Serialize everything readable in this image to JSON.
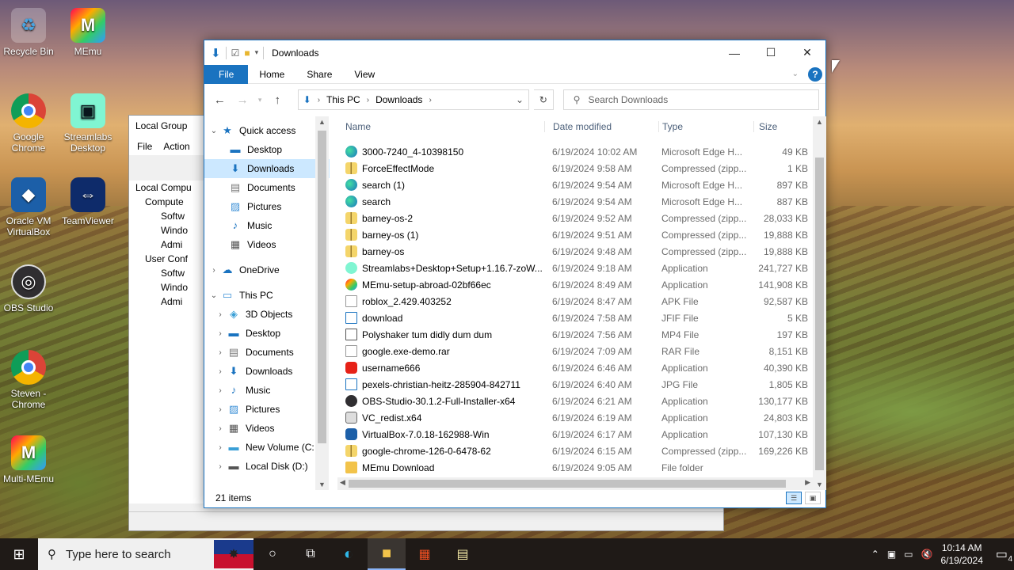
{
  "desktop": {
    "icons": [
      {
        "label": "Recycle Bin",
        "icon": "recycle-bin-icon"
      },
      {
        "label": "MEmu",
        "icon": "memu-icon"
      },
      {
        "label": "Google Chrome",
        "icon": "chrome-icon"
      },
      {
        "label": "Streamlabs Desktop",
        "icon": "streamlabs-icon"
      },
      {
        "label": "Oracle VM VirtualBox",
        "icon": "virtualbox-icon"
      },
      {
        "label": "TeamViewer",
        "icon": "teamviewer-icon"
      },
      {
        "label": "OBS Studio",
        "icon": "obs-icon"
      },
      {
        "label": "Steven - Chrome",
        "icon": "chrome-profile-icon"
      },
      {
        "label": "Multi-MEmu",
        "icon": "multi-memu-icon"
      }
    ]
  },
  "bg_window": {
    "title": "Local Group",
    "menu": [
      "File",
      "Action"
    ],
    "tree": [
      "Local Compu",
      "Compute",
      "Softw",
      "Windo",
      "Admi",
      "User Conf",
      "Softw",
      "Windo",
      "Admi"
    ]
  },
  "explorer": {
    "title": "Downloads",
    "ribbon": {
      "file": "File",
      "home": "Home",
      "share": "Share",
      "view": "View",
      "help": "?"
    },
    "breadcrumb": [
      "This PC",
      "Downloads"
    ],
    "search_placeholder": "Search Downloads",
    "nav": {
      "quick_access": "Quick access",
      "quick_items": [
        "Desktop",
        "Downloads",
        "Documents",
        "Pictures",
        "Music",
        "Videos"
      ],
      "onedrive": "OneDrive",
      "this_pc": "This PC",
      "pc_items": [
        "3D Objects",
        "Desktop",
        "Documents",
        "Downloads",
        "Music",
        "Pictures",
        "Videos",
        "New Volume (C:",
        "Local Disk (D:)"
      ]
    },
    "columns": {
      "name": "Name",
      "date": "Date modified",
      "type": "Type",
      "size": "Size"
    },
    "files": [
      {
        "name": "3000-7240_4-10398150",
        "date": "6/19/2024 10:02 AM",
        "type": "Microsoft Edge H...",
        "size": "49 KB",
        "icon": "edge"
      },
      {
        "name": "ForceEffectMode",
        "date": "6/19/2024 9:58 AM",
        "type": "Compressed (zipp...",
        "size": "1 KB",
        "icon": "zip"
      },
      {
        "name": "search (1)",
        "date": "6/19/2024 9:54 AM",
        "type": "Microsoft Edge H...",
        "size": "897 KB",
        "icon": "edge"
      },
      {
        "name": "search",
        "date": "6/19/2024 9:54 AM",
        "type": "Microsoft Edge H...",
        "size": "887 KB",
        "icon": "edge"
      },
      {
        "name": "barney-os-2",
        "date": "6/19/2024 9:52 AM",
        "type": "Compressed (zipp...",
        "size": "28,033 KB",
        "icon": "zip"
      },
      {
        "name": "barney-os (1)",
        "date": "6/19/2024 9:51 AM",
        "type": "Compressed (zipp...",
        "size": "19,888 KB",
        "icon": "zip"
      },
      {
        "name": "barney-os",
        "date": "6/19/2024 9:48 AM",
        "type": "Compressed (zipp...",
        "size": "19,888 KB",
        "icon": "zip"
      },
      {
        "name": "Streamlabs+Desktop+Setup+1.16.7-zoW...",
        "date": "6/19/2024 9:18 AM",
        "type": "Application",
        "size": "241,727 KB",
        "icon": "streamlabs"
      },
      {
        "name": "MEmu-setup-abroad-02bf66ec",
        "date": "6/19/2024 8:49 AM",
        "type": "Application",
        "size": "141,908 KB",
        "icon": "memu"
      },
      {
        "name": "roblox_2.429.403252",
        "date": "6/19/2024 8:47 AM",
        "type": "APK File",
        "size": "92,587 KB",
        "icon": "file"
      },
      {
        "name": "download",
        "date": "6/19/2024 7:58 AM",
        "type": "JFIF File",
        "size": "5 KB",
        "icon": "image"
      },
      {
        "name": "Polyshaker tum didly dum dum",
        "date": "6/19/2024 7:56 AM",
        "type": "MP4 File",
        "size": "197 KB",
        "icon": "video"
      },
      {
        "name": "google.exe-demo.rar",
        "date": "6/19/2024 7:09 AM",
        "type": "RAR File",
        "size": "8,151 KB",
        "icon": "file"
      },
      {
        "name": "username666",
        "date": "6/19/2024 6:46 AM",
        "type": "Application",
        "size": "40,390 KB",
        "icon": "youtube"
      },
      {
        "name": "pexels-christian-heitz-285904-842711",
        "date": "6/19/2024 6:40 AM",
        "type": "JPG File",
        "size": "1,805 KB",
        "icon": "image"
      },
      {
        "name": "OBS-Studio-30.1.2-Full-Installer-x64",
        "date": "6/19/2024 6:21 AM",
        "type": "Application",
        "size": "130,177 KB",
        "icon": "obs"
      },
      {
        "name": "VC_redist.x64",
        "date": "6/19/2024 6:19 AM",
        "type": "Application",
        "size": "24,803 KB",
        "icon": "installer"
      },
      {
        "name": "VirtualBox-7.0.18-162988-Win",
        "date": "6/19/2024 6:17 AM",
        "type": "Application",
        "size": "107,130 KB",
        "icon": "virtualbox"
      },
      {
        "name": "google-chrome-126-0-6478-62",
        "date": "6/19/2024 6:15 AM",
        "type": "Compressed (zipp...",
        "size": "169,226 KB",
        "icon": "zip"
      },
      {
        "name": "MEmu Download",
        "date": "6/19/2024 9:05 AM",
        "type": "File folder",
        "size": "",
        "icon": "folder"
      }
    ],
    "status": "21 items"
  },
  "taskbar": {
    "search_placeholder": "Type here to search",
    "time": "10:14 AM",
    "date": "6/19/2024",
    "notifications": "4"
  },
  "colors": {
    "accent": "#1a73c0",
    "selection": "#cce8ff",
    "taskbar": "#1f1a17"
  }
}
